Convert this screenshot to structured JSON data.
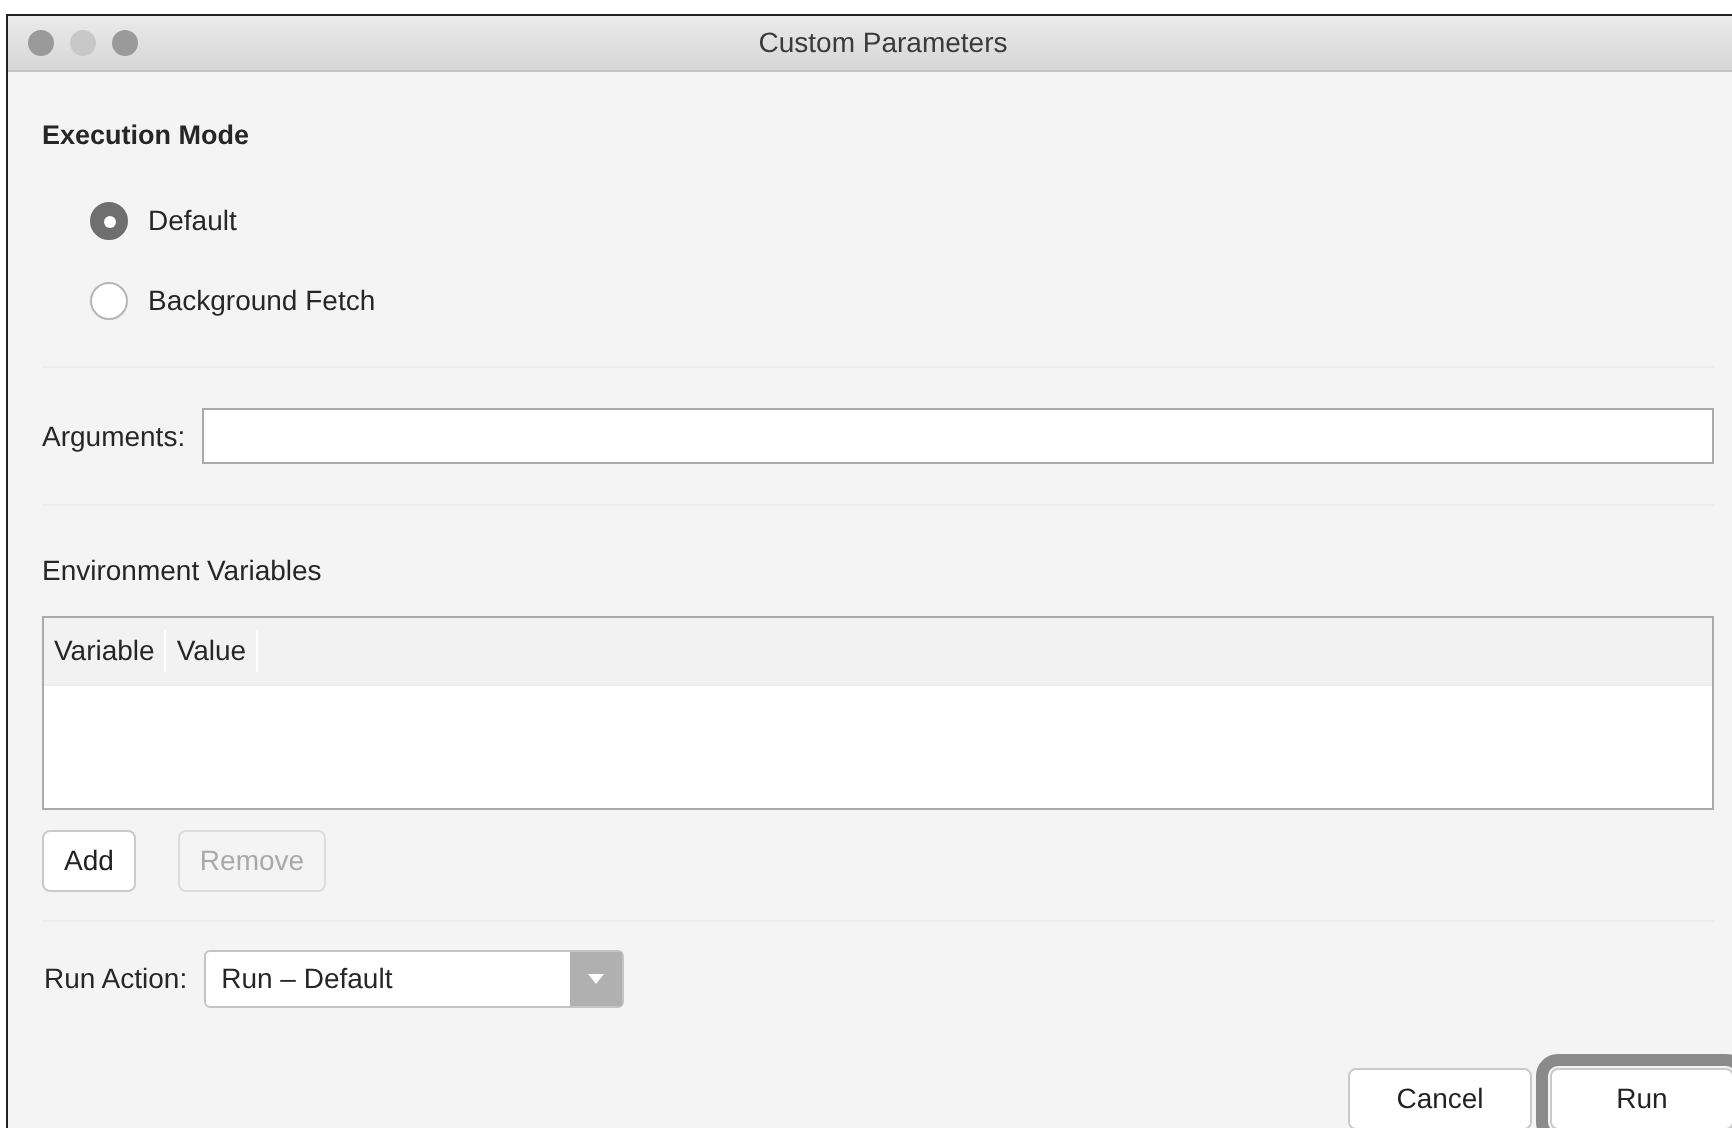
{
  "window": {
    "title": "Custom Parameters"
  },
  "execution_mode": {
    "heading": "Execution Mode",
    "options": [
      {
        "label": "Default",
        "selected": true
      },
      {
        "label": "Background Fetch",
        "selected": false
      }
    ]
  },
  "arguments": {
    "label": "Arguments:"
  },
  "environment": {
    "heading": "Environment Variables",
    "columns": [
      "Variable",
      "Value"
    ]
  },
  "env_buttons": [
    {
      "label": "Add",
      "disabled": false
    },
    {
      "label": "Remove",
      "disabled": true
    }
  ],
  "run_action": {
    "label": "Run Action:",
    "value": "Run – Default"
  },
  "buttons": [
    {
      "label": "Cancel",
      "highlighted": false
    },
    {
      "label": "Run",
      "highlighted": true
    }
  ]
}
